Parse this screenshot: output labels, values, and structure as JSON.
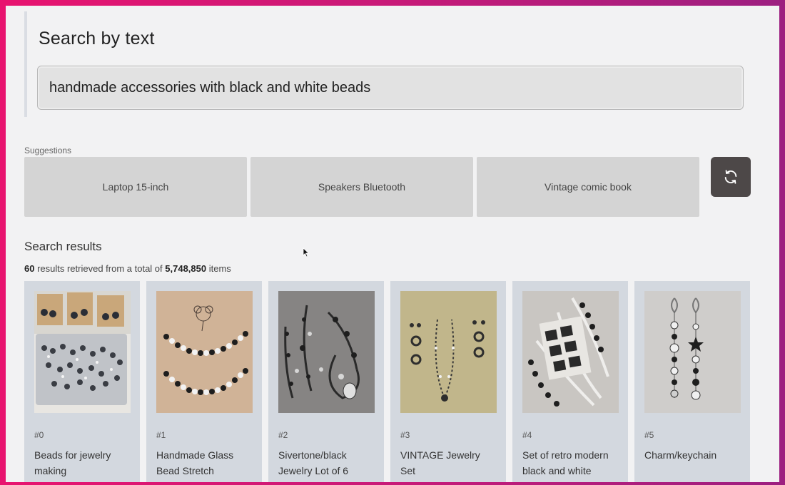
{
  "search": {
    "title": "Search by text",
    "query": "handmade accessories with black and white beads"
  },
  "suggestions": {
    "label": "Suggestions",
    "items": [
      "Laptop 15-inch",
      "Speakers Bluetooth",
      "Vintage comic book"
    ],
    "refresh_icon": "refresh-icon"
  },
  "results": {
    "title": "Search results",
    "count": "60",
    "text_mid": " results retrieved from a total of ",
    "total": "5,748,850",
    "text_end": " items",
    "items": [
      {
        "index": "#0",
        "name": "Beads for jewelry making"
      },
      {
        "index": "#1",
        "name": "Handmade Glass Bead Stretch"
      },
      {
        "index": "#2",
        "name": "Sivertone/black Jewelry Lot of 6"
      },
      {
        "index": "#3",
        "name": "VINTAGE Jewelry Set"
      },
      {
        "index": "#4",
        "name": "Set of retro modern black and white"
      },
      {
        "index": "#5",
        "name": "Charm/keychain"
      }
    ]
  },
  "colors": {
    "accent": "#4d4848",
    "suggestion_bg": "#d4d4d4",
    "card_bg": "#d3d8df",
    "frame_border": "#e8146f"
  }
}
